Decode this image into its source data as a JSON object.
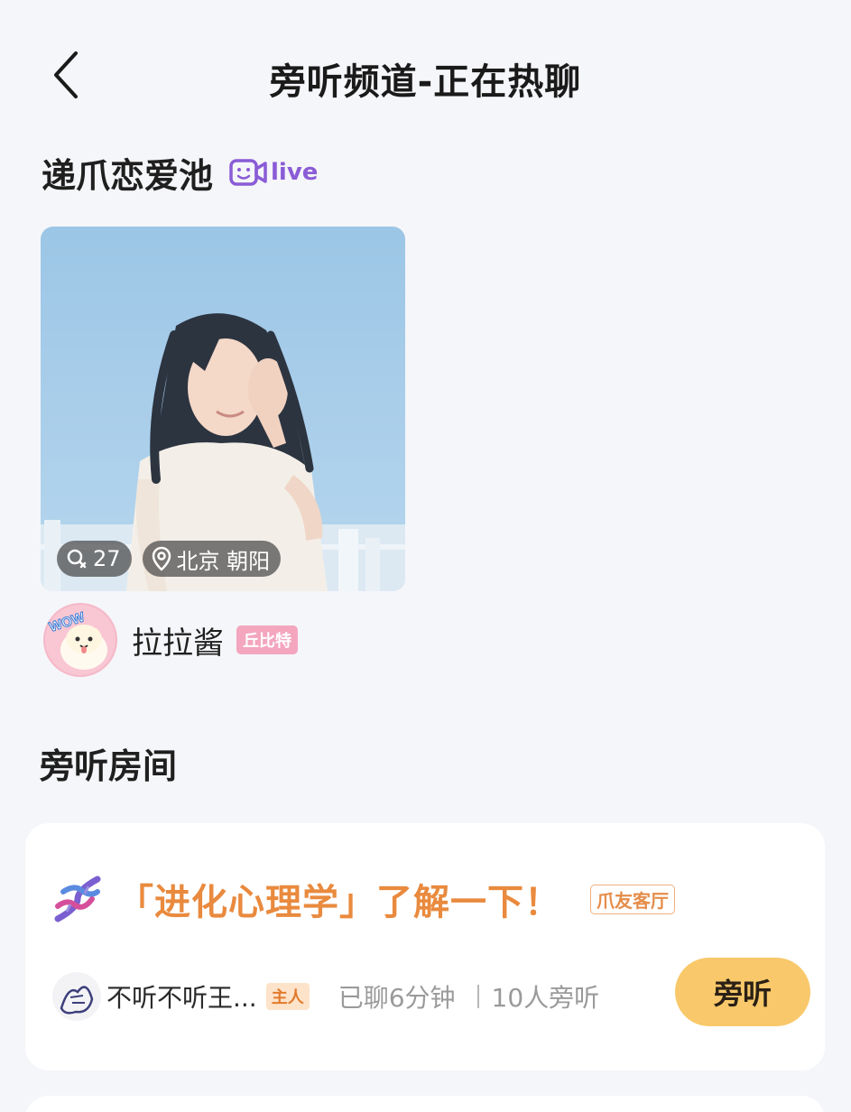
{
  "header": {
    "title": "旁听频道-正在热聊"
  },
  "live_section": {
    "title": "递爪恋爱池",
    "live_label": "live"
  },
  "profile_card": {
    "age": "27",
    "location": "北京 朝阳",
    "username": "拉拉酱",
    "badge": "丘比特"
  },
  "rooms_section": {
    "title": "旁听房间"
  },
  "room": {
    "title": "「进化心理学」了解一下！",
    "tag": "爪友客厅",
    "host_name": "不听不听王...",
    "host_badge": "主人",
    "chat_time": "已聊6分钟",
    "listeners": "10人旁听",
    "listen_button": "旁听"
  },
  "colors": {
    "background": "#f5f6f9",
    "live_purple": "#8a5cd6",
    "room_title_orange": "#e98a3e",
    "listen_button": "#f8c86a",
    "cupid_pink": "#f4a6bf"
  },
  "icons": {
    "back": "chevron-left-icon",
    "live": "video-camera-icon",
    "age": "search-age-icon",
    "location": "location-pin-icon",
    "dna": "dna-icon"
  }
}
